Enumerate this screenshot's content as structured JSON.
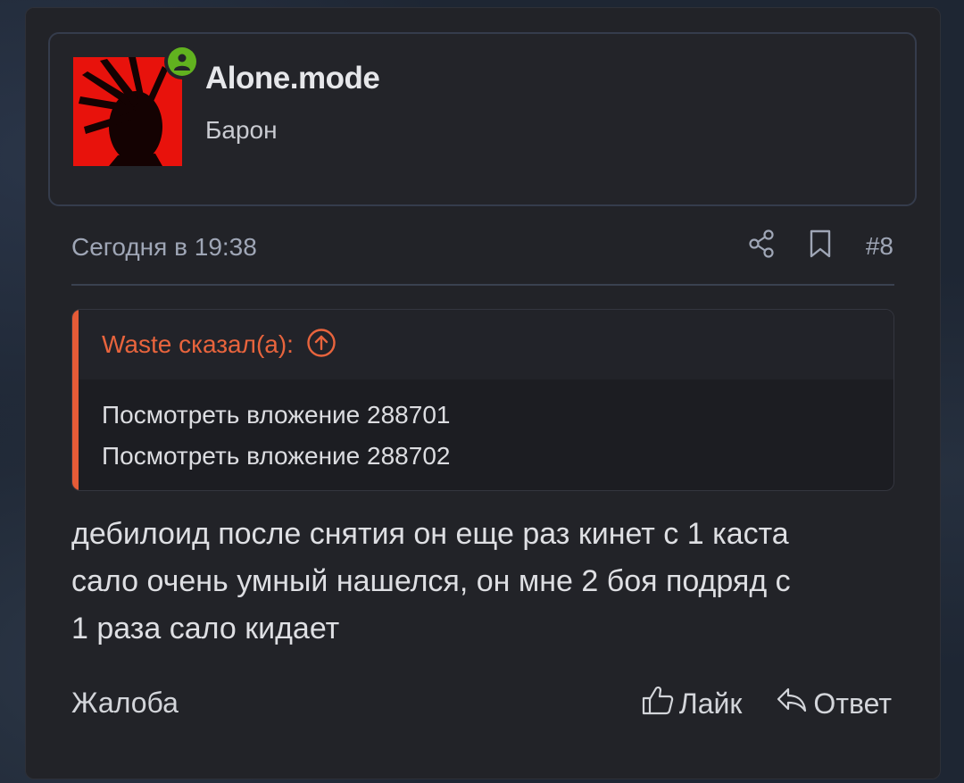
{
  "user": {
    "name": "Alone.mode",
    "title": "Барон",
    "online": true
  },
  "post": {
    "date": "Сегодня в 19:38",
    "number": "#8",
    "quote": {
      "author": "Waste сказал(а):",
      "lines": [
        "Посмотреть вложение 288701",
        "Посмотреть вложение 288702"
      ]
    },
    "message_lines": [
      "дебилоид после снятия он еще раз кинет с 1 каста",
      "сало очень умный нашелся, он мне 2 боя подряд с",
      "1 раза сало кидает"
    ]
  },
  "actions": {
    "report": "Жалоба",
    "like": "Лайк",
    "reply": "Ответ"
  },
  "icons": {
    "online": "user-online-icon",
    "share": "share-icon",
    "bookmark": "bookmark-icon",
    "quote_up": "arrow-up-circle-icon",
    "like": "thumbs-up-icon",
    "reply": "reply-icon"
  },
  "colors": {
    "accent_quote": "#e8643d",
    "online": "#61b21f"
  }
}
